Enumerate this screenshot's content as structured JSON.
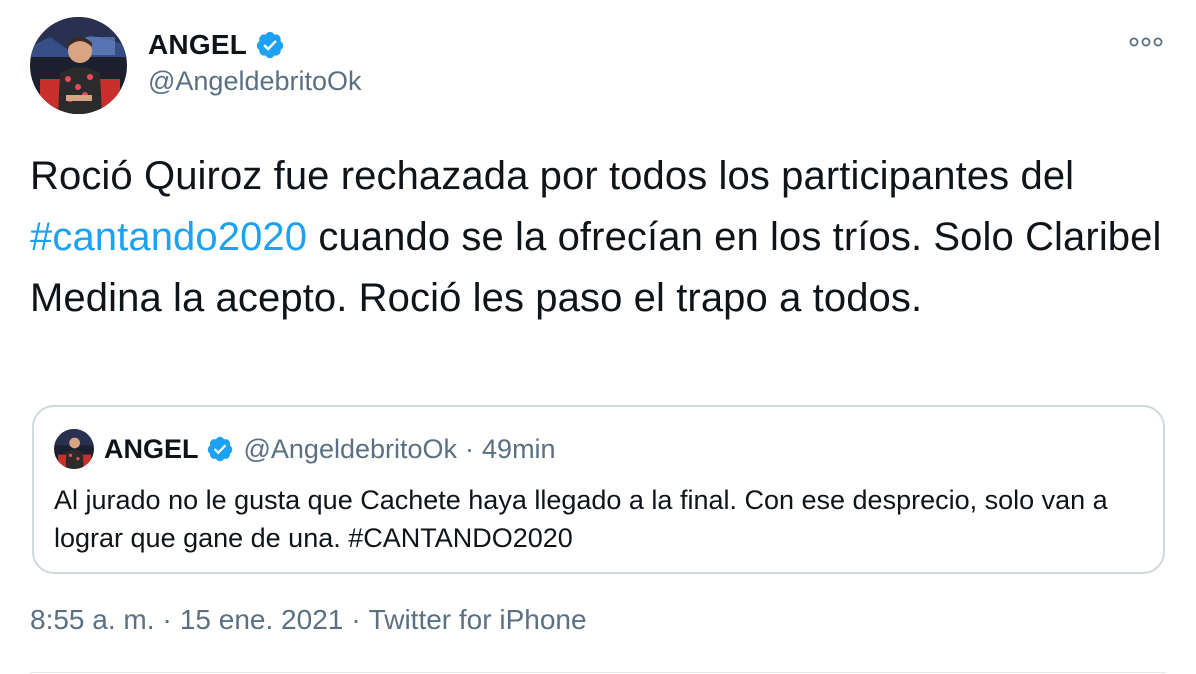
{
  "tweet": {
    "author": {
      "display_name": "ANGEL",
      "handle": "@AngeldebritoOk",
      "verified": true,
      "avatar_icon": "profile-photo"
    },
    "text": {
      "before_hashtag": "Roció Quiroz fue rechazada por todos los participantes del ",
      "hashtag": "#cantando2020",
      "after_hashtag": " cuando se la ofrecían en los tríos. Solo Claribel Medina la acepto. Roció les paso el trapo a todos."
    },
    "quoted": {
      "display_name": "ANGEL",
      "handle": "@AngeldebritoOk",
      "separator": "·",
      "time": "49min",
      "text": "Al jurado no le gusta que Cachete haya llegado a la final. Con ese desprecio, solo van a lograr que gane de una. #CANTANDO2020"
    },
    "meta": {
      "time": "8:55 a. m.",
      "date": "15 ene. 2021",
      "source": "Twitter for iPhone",
      "separator": "·"
    }
  },
  "colors": {
    "accent": "#1da1f2",
    "text": "#0f1419",
    "secondary": "#5b7083",
    "border": "#cfd9de"
  }
}
